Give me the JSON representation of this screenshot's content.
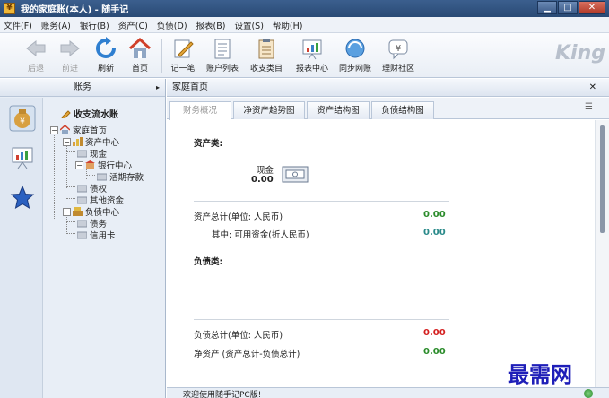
{
  "window": {
    "title": "我的家庭账(本人) - 随手记",
    "app_icon": "¥"
  },
  "menu": [
    "文件(F)",
    "账务(A)",
    "银行(B)",
    "资产(C)",
    "负债(D)",
    "报表(B)",
    "设置(S)",
    "帮助(H)"
  ],
  "toolbar": {
    "back": "后退",
    "forward": "前进",
    "refresh": "刷新",
    "home": "首页",
    "record": "记一笔",
    "accounts": "账户列表",
    "categories": "收支类目",
    "reports": "报表中心",
    "sync": "同步网账",
    "community": "理财社区",
    "brand": "King"
  },
  "left": {
    "header": "账务",
    "quick": "收支流水账",
    "tree": [
      "家庭首页",
      "资产中心",
      "现金",
      "银行中心",
      "活期存款",
      "债权",
      "其他资金",
      "负债中心",
      "债务",
      "信用卡"
    ]
  },
  "right": {
    "header": "家庭首页",
    "tabs": [
      "财务概况",
      "净资产趋势图",
      "资产结构图",
      "负债结构图"
    ],
    "assets_title": "资产类:",
    "cash_label": "现金",
    "cash_value": "0.00",
    "asset_total_label": "资产总计(单位: 人民币)",
    "asset_total_value": "0.00",
    "available_label": "其中: 可用资金(折人民币)",
    "available_value": "0.00",
    "liab_title": "负债类:",
    "liab_total_label": "负债总计(单位: 人民币)",
    "liab_total_value": "0.00",
    "net_label": "净资产 (资产总计-负债总计)",
    "net_value": "0.00"
  },
  "status": {
    "text": "欢迎使用随手记PC版!"
  },
  "watermark": "最需网",
  "colors": {
    "accent": "#2a4a75",
    "positive": "#2b8c2b",
    "negative": "#d42020"
  }
}
